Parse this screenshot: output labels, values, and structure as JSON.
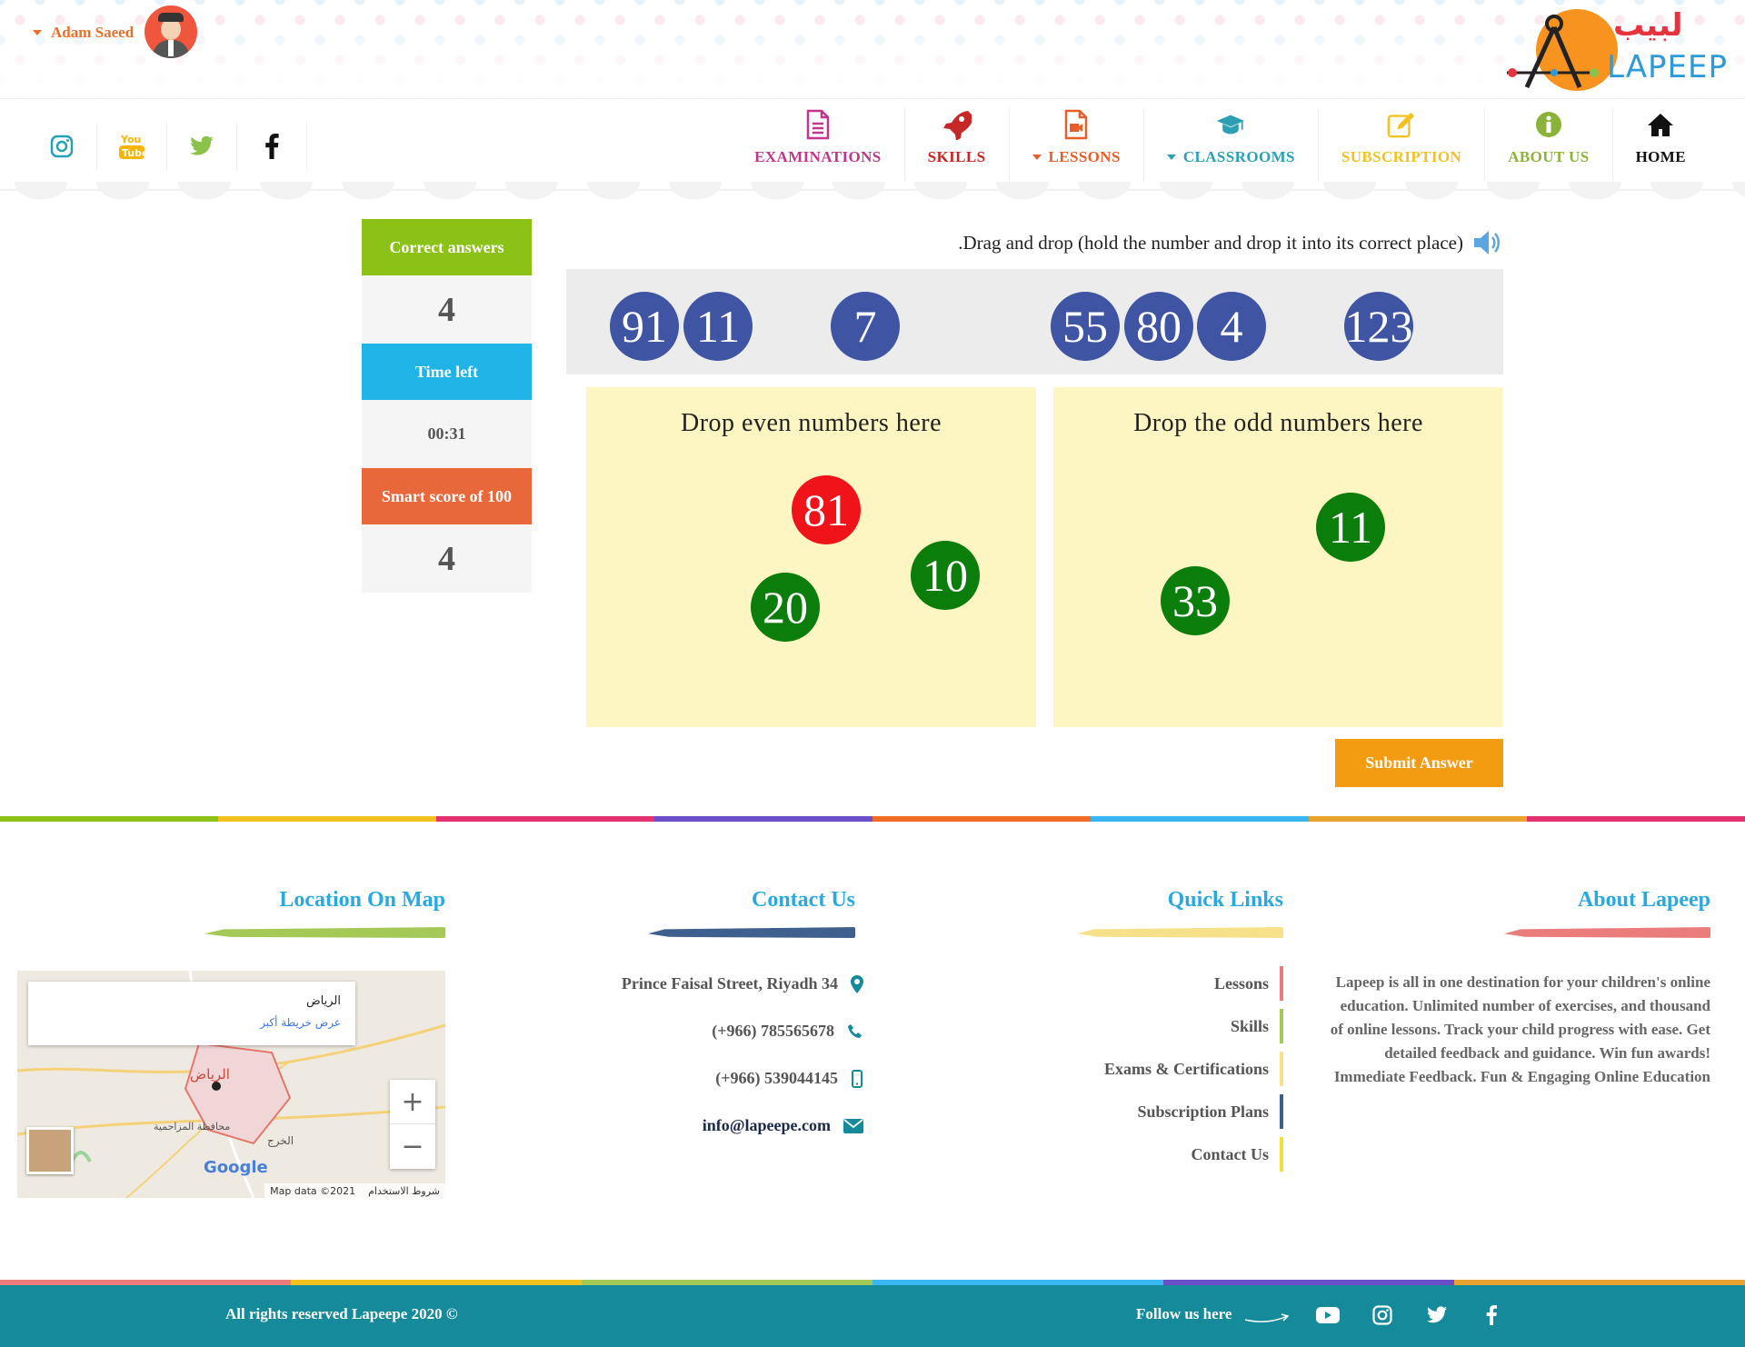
{
  "header": {
    "user_name": "Adam Saeed",
    "logo_arabic": "لبيب",
    "logo_latin": "LAPEEP"
  },
  "social": [
    {
      "icon": "instagram-icon",
      "color": "#25a1b5"
    },
    {
      "icon": "youtube-icon",
      "color": "#f7b500"
    },
    {
      "icon": "twitter-icon",
      "color": "#8bc34a"
    },
    {
      "icon": "facebook-icon",
      "color": "#111111"
    }
  ],
  "nav": [
    {
      "label": "EXAMINATIONS",
      "icon": "document-icon",
      "color": "#c2358d",
      "dropdown": false
    },
    {
      "label": "SKILLS",
      "icon": "rocket-icon",
      "color": "#c62828",
      "dropdown": false
    },
    {
      "label": "LESSONS",
      "icon": "video-file-icon",
      "color": "#e65f2b",
      "dropdown": true
    },
    {
      "label": "CLASSROOMS",
      "icon": "graduation-cap-icon",
      "color": "#2c9fb3",
      "dropdown": true
    },
    {
      "label": "SUBSCRIPTION",
      "icon": "edit-icon",
      "color": "#f4c21f",
      "dropdown": false
    },
    {
      "label": "ABOUT US",
      "icon": "info-icon",
      "color": "#8bb33a",
      "dropdown": false
    },
    {
      "label": "HOME",
      "icon": "home-icon",
      "color": "#111111",
      "dropdown": false
    }
  ],
  "score_panel": {
    "correct_label": "Correct answers",
    "correct_value": "4",
    "time_label": "Time left",
    "time_value": "00:31",
    "smart_label": "Smart score of 100",
    "smart_value": "4",
    "colors": {
      "correct": "#8cc218",
      "time": "#1fb3e6",
      "smart": "#e9683b"
    }
  },
  "game": {
    "instruction": ".Drag and drop (hold the number and drop it into its correct place)",
    "tray_numbers": [
      "91",
      "11",
      "7",
      "55",
      "80",
      "4",
      "123"
    ],
    "even_zone_title": "Drop even numbers here",
    "odd_zone_title": "Drop the odd numbers here",
    "even_zone_numbers": [
      {
        "value": "81",
        "state": "wrong"
      },
      {
        "value": "10",
        "state": "correct"
      },
      {
        "value": "20",
        "state": "correct"
      }
    ],
    "odd_zone_numbers": [
      {
        "value": "11",
        "state": "correct"
      },
      {
        "value": "33",
        "state": "correct"
      }
    ],
    "submit_label": "Submit Answer"
  },
  "footer": {
    "location_title": "Location On Map",
    "contact_title": "Contact Us",
    "quick_title": "Quick Links",
    "about_title": "About Lapeep",
    "map": {
      "place_name": "الرياض",
      "larger_map": "عرض خريطة أكبر",
      "city_label": "الرياض",
      "area_label_1": "محافظة المزاحمية",
      "area_label_2": "الخرج",
      "brand": "Google",
      "data": "Map data ©2021",
      "terms": "شروط الاستخدام",
      "zoom_in": "+",
      "zoom_out": "−"
    },
    "contacts": [
      {
        "text": "Prince Faisal Street, Riyadh 34",
        "icon": "location-pin-icon"
      },
      {
        "text": "(+966) 785565678",
        "icon": "phone-icon"
      },
      {
        "text": "(+966) 539044145",
        "icon": "mobile-icon"
      },
      {
        "text": "info@lapeepe.com",
        "icon": "envelope-icon"
      }
    ],
    "quick_links": [
      {
        "text": "Lessons",
        "color": "#ea7c7c"
      },
      {
        "text": "Skills",
        "color": "#a4c957"
      },
      {
        "text": "Exams & Certifications",
        "color": "#f7e08a"
      },
      {
        "text": "Subscription Plans",
        "color": "#3f5f8f"
      },
      {
        "text": "Contact Us",
        "color": "#f1e23a"
      }
    ],
    "about_text": "Lapeep is all in one destination for your children's online education. Unlimited number of exercises, and thousand of online lessons. Track your child progress with ease. Get detailed feedback and guidance. Win fun awards! Immediate Feedback. Fun & Engaging Online Education",
    "rights": "All rights reserved Lapeepe 2020 ©",
    "follow": "Follow us here"
  }
}
